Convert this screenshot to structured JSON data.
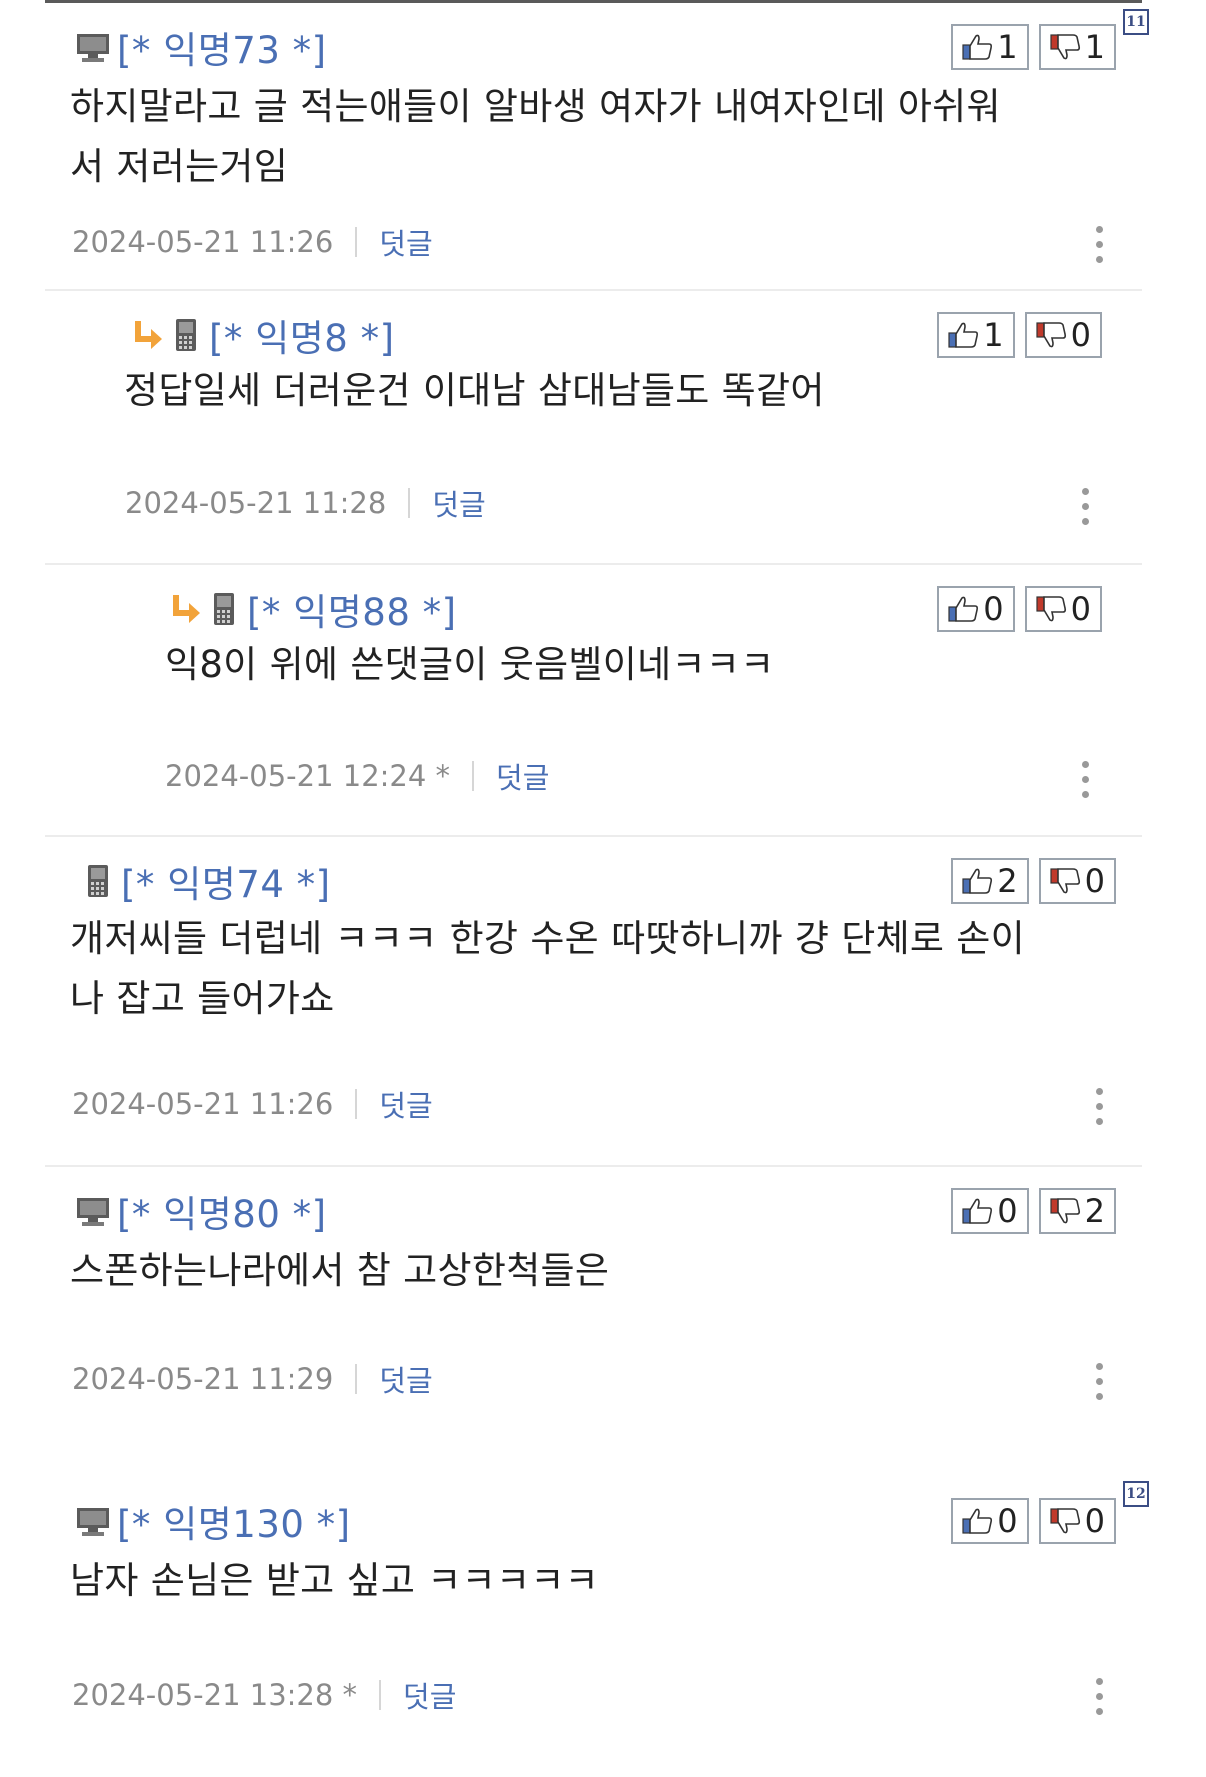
{
  "comments": [
    {
      "author": "[* 익명73 *]",
      "device": "desktop",
      "reply": false,
      "up": "1",
      "down": "1",
      "text_line1": "하지말라고 글 적는애들이 알바생 여자가 내여자인데 아쉬워",
      "text_line2": "서 저러는거임",
      "date": "2024-05-21 11:26",
      "reply_label": "덧글",
      "page_badge": "11"
    },
    {
      "author": "[* 익명8 *]",
      "device": "mobile",
      "reply": true,
      "up": "1",
      "down": "0",
      "text_line1": "정답일세 더러운건 이대남 삼대남들도 똑같어",
      "date": "2024-05-21 11:28",
      "reply_label": "덧글"
    },
    {
      "author": "[* 익명88 *]",
      "device": "mobile",
      "reply": true,
      "up": "0",
      "down": "0",
      "text_line1": "익8이 위에 쓴댓글이 웃음벨이네ㅋㅋㅋ",
      "date": "2024-05-21 12:24 *",
      "reply_label": "덧글"
    },
    {
      "author": "[* 익명74 *]",
      "device": "mobile",
      "reply": false,
      "up": "2",
      "down": "0",
      "text_line1": "개저씨들 더럽네 ㅋㅋㅋ 한강 수온 따땃하니까 걍 단체로 손이",
      "text_line2": "나 잡고 들어가쇼",
      "date": "2024-05-21 11:26",
      "reply_label": "덧글"
    },
    {
      "author": "[* 익명80 *]",
      "device": "desktop",
      "reply": false,
      "up": "0",
      "down": "2",
      "text_line1": "스폰하는나라에서 참 고상한척들은",
      "date": "2024-05-21 11:29",
      "reply_label": "덧글"
    },
    {
      "author": "[* 익명130 *]",
      "device": "desktop",
      "reply": false,
      "up": "0",
      "down": "0",
      "text_line1": "남자 손님은 받고 싶고 ㅋㅋㅋㅋㅋ",
      "date": "2024-05-21 13:28 *",
      "reply_label": "덧글",
      "page_badge": "12"
    }
  ],
  "icons": {
    "desktop": "monitor-icon",
    "mobile": "phone-icon",
    "reply_arrow": "reply-arrow-icon",
    "up": "thumbs-up-icon",
    "down": "thumbs-down-icon",
    "more": "kebab-menu-icon"
  },
  "colors": {
    "author": "#4a6fb4",
    "arrow": "#f2a33a",
    "down_cuff": "#c0392b",
    "up_cuff": "#4a6fb4"
  }
}
